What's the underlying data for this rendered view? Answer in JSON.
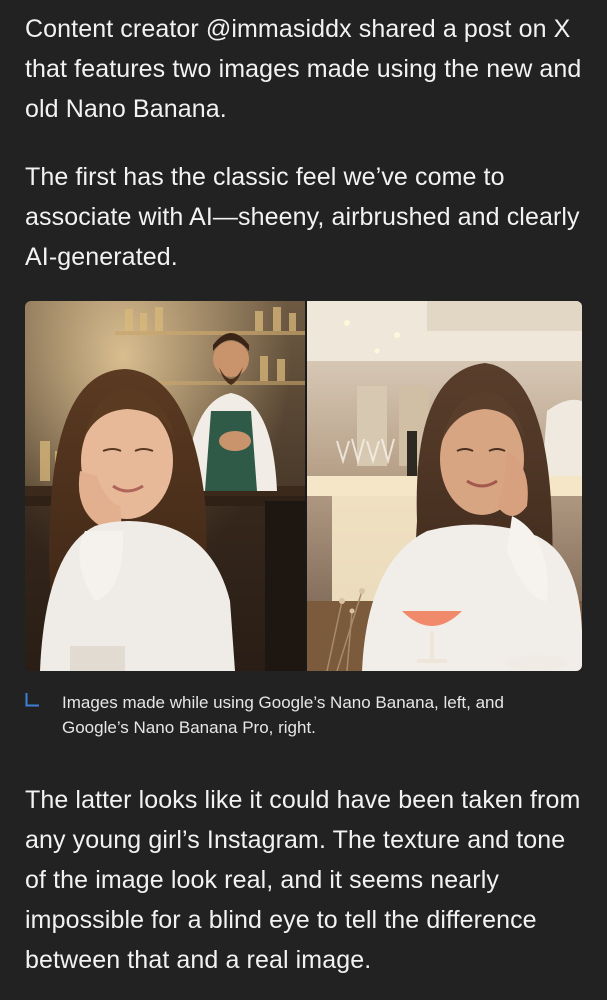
{
  "article": {
    "paragraph_1": "Content creator @immasiddx shared a post on X that features two images made using the new and old Nano Banana.",
    "paragraph_2": "The first has the classic feel we’ve come to associate with AI—sheeny, airbrushed and clearly AI-generated.",
    "paragraph_3": "The latter looks like it could have been taken from any young girl’s Instagram. The texture and tone of the image look real, and it seems nearly impossible for a blind eye to tell the difference between that and a real image."
  },
  "figure": {
    "caption": "Images made while using Google’s Nano Banana, left, and Google’s Nano Banana Pro, right."
  },
  "colors": {
    "background": "#222222",
    "text": "#f2f2f2",
    "caption_icon": "#3b82d6"
  }
}
